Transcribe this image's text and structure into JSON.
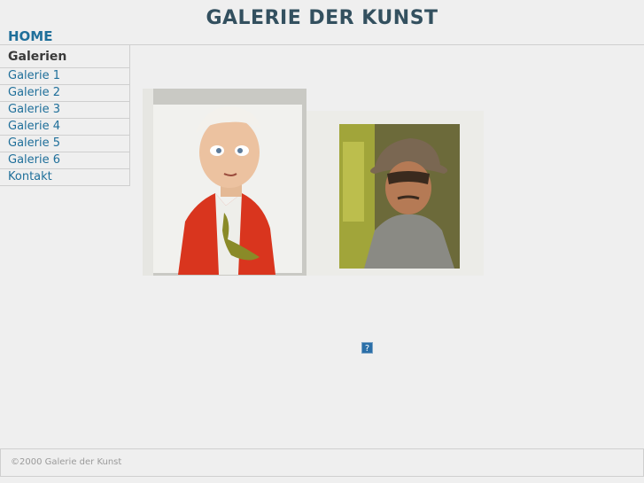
{
  "header": {
    "title": "GALERIE DER KUNST",
    "home_label": "HOME"
  },
  "sidebar": {
    "heading": "Galerien",
    "items": [
      {
        "label": "Galerie 1"
      },
      {
        "label": "Galerie 2"
      },
      {
        "label": "Galerie 3"
      },
      {
        "label": "Galerie 4"
      },
      {
        "label": "Galerie 5"
      },
      {
        "label": "Galerie 6"
      },
      {
        "label": "Kontakt"
      }
    ]
  },
  "main": {
    "broken_image_glyph": "?"
  },
  "footer": {
    "copyright": "©2000 Galerie der Kunst"
  },
  "colors": {
    "background": "#efefef",
    "title": "#33505f",
    "link": "#1f6f9a",
    "border": "#cfcfcf"
  }
}
